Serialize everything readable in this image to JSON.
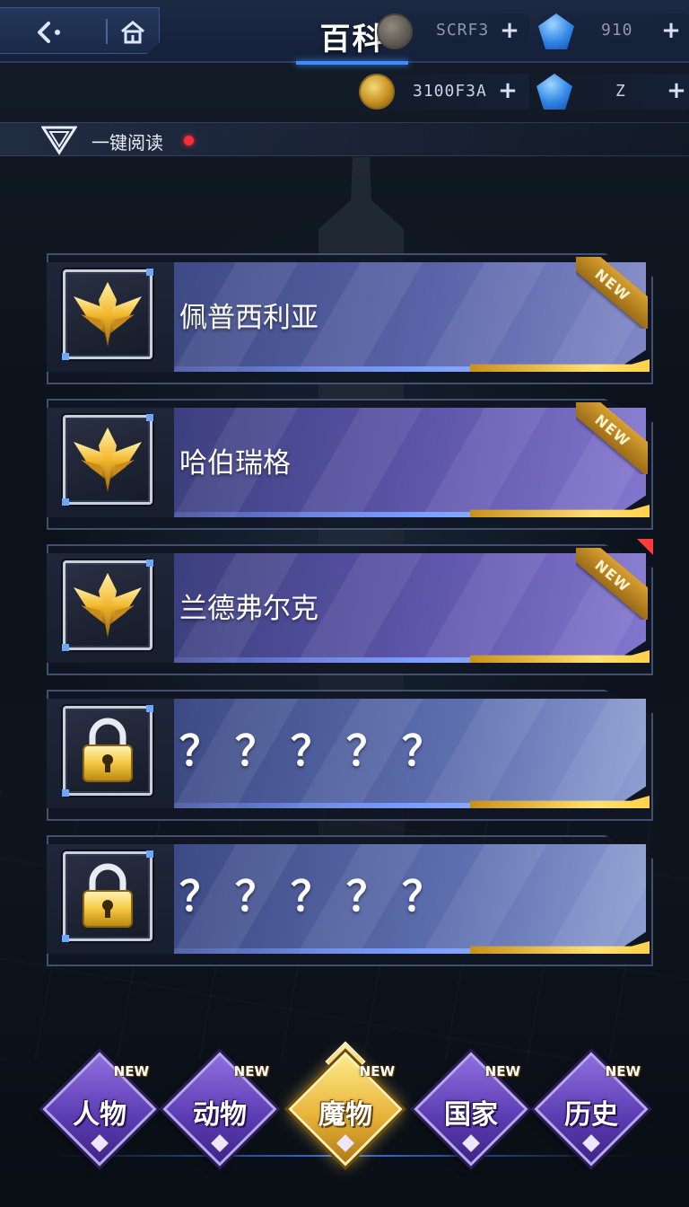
{
  "header": {
    "title": "百科",
    "back_icon": "back-arrow-icon",
    "home_icon": "home-icon"
  },
  "currencies": {
    "row1": [
      {
        "icon": "coin-dim-icon",
        "value": "SCRF3",
        "plus": "+"
      },
      {
        "icon": "gem-icon",
        "value": "910",
        "plus": "+"
      }
    ],
    "row2": [
      {
        "icon": "coin-icon",
        "value": "3100F3A",
        "plus": "+"
      },
      {
        "icon": "gem-icon",
        "value": "Z",
        "plus": "+"
      }
    ]
  },
  "read_all": {
    "label": "一键阅读",
    "has_notification": true
  },
  "entries": [
    {
      "name": "佩普西利亚",
      "locked": false,
      "is_new": true,
      "badge": "NEW"
    },
    {
      "name": "哈伯瑞格",
      "locked": false,
      "is_new": true,
      "badge": "NEW"
    },
    {
      "name": "兰德弗尔克",
      "locked": false,
      "is_new": true,
      "badge": "NEW"
    },
    {
      "name": "？？？？？",
      "locked": true
    },
    {
      "name": "？？？？？",
      "locked": true
    }
  ],
  "categories": [
    {
      "label": "人物",
      "badge": "NEW",
      "active": false
    },
    {
      "label": "动物",
      "badge": "NEW",
      "active": false
    },
    {
      "label": "魔物",
      "badge": "NEW",
      "active": true
    },
    {
      "label": "国家",
      "badge": "NEW",
      "active": false
    },
    {
      "label": "历史",
      "badge": "NEW",
      "active": false
    }
  ],
  "colors": {
    "accent_blue": "#3f8cff",
    "gold": "#ffd24a",
    "category_purple": "#5a3ab0",
    "notification_red": "#ff2a3a"
  }
}
